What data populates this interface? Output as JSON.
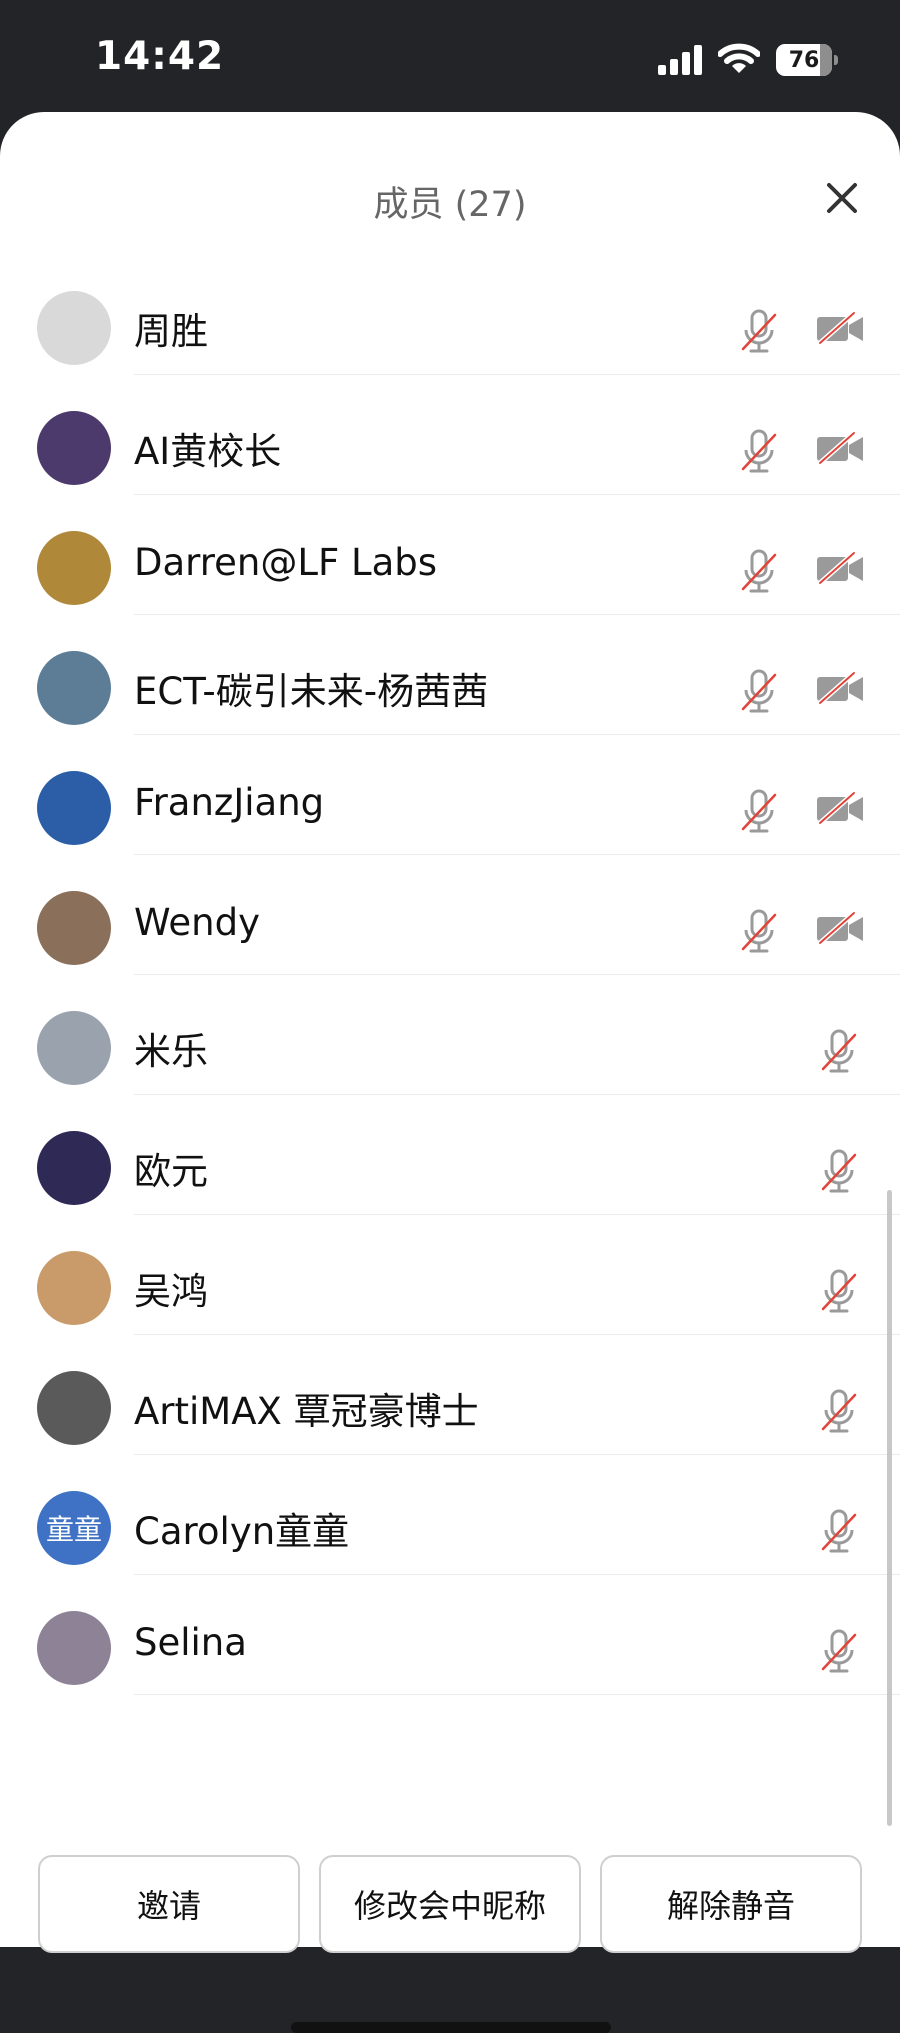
{
  "status_bar": {
    "time": "14:42",
    "battery": "76"
  },
  "sheet": {
    "title": "成员 (27)",
    "close_icon": "close-icon"
  },
  "members": [
    {
      "name": "周胜",
      "avatar_color": "#d9d9d9",
      "avatar_text": "",
      "mic": "mic-off-icon",
      "camera": "camera-off-icon"
    },
    {
      "name": "AI黄校长",
      "avatar_color": "#4b3a6b",
      "avatar_text": "",
      "mic": "mic-off-icon",
      "camera": "camera-off-icon"
    },
    {
      "name": "Darren@LF Labs",
      "avatar_color": "#b0883a",
      "avatar_text": "",
      "mic": "mic-off-icon",
      "camera": "camera-off-icon"
    },
    {
      "name": "ECT-碳引未来-杨茜茜",
      "avatar_color": "#5d7d96",
      "avatar_text": "",
      "mic": "mic-off-icon",
      "camera": "camera-off-icon"
    },
    {
      "name": "FranzJiang",
      "avatar_color": "#2c5ea8",
      "avatar_text": "",
      "mic": "mic-off-icon",
      "camera": "camera-off-icon"
    },
    {
      "name": "Wendy",
      "avatar_color": "#8a6f5a",
      "avatar_text": "",
      "mic": "mic-off-icon",
      "camera": "camera-off-icon"
    },
    {
      "name": "米乐",
      "avatar_color": "#9aa3ad",
      "avatar_text": "",
      "mic": "mic-off-icon",
      "camera": ""
    },
    {
      "name": "欧元",
      "avatar_color": "#2e2a55",
      "avatar_text": "",
      "mic": "mic-off-icon",
      "camera": ""
    },
    {
      "name": "吴鸿",
      "avatar_color": "#c99a6a",
      "avatar_text": "",
      "mic": "mic-off-icon",
      "camera": ""
    },
    {
      "name": "ArtiMAX 覃冠豪博士",
      "avatar_color": "#5a5a5a",
      "avatar_text": "",
      "mic": "mic-off-icon",
      "camera": ""
    },
    {
      "name": "Carolyn童童",
      "avatar_color": "#3f72c4",
      "avatar_text": "童童",
      "mic": "mic-off-icon",
      "camera": ""
    },
    {
      "name": "Selina",
      "avatar_color": "#8d8296",
      "avatar_text": "",
      "mic": "mic-off-icon",
      "camera": ""
    }
  ],
  "actions": {
    "invite": "邀请",
    "rename": "修改会中昵称",
    "unmute": "解除静音"
  },
  "colors": {
    "icon_gray": "#9a9a9a",
    "mute_slash": "#e0443a"
  }
}
